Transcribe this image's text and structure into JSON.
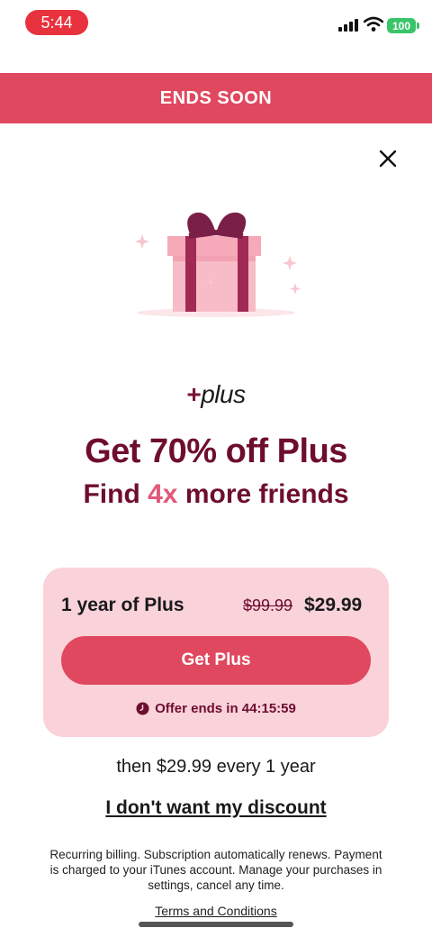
{
  "status_bar": {
    "time": "5:44",
    "battery": "100",
    "battery_color": "#3ac46a",
    "time_pill_color": "#e8323e"
  },
  "banner": {
    "text": "ENDS SOON",
    "color": "#e0485f"
  },
  "brand": {
    "sign": "+",
    "name": "plus"
  },
  "headline": "Get 70% off Plus",
  "subhead": {
    "prefix": "Find ",
    "highlight": "4x",
    "suffix": " more friends"
  },
  "offer": {
    "plan": "1 year of Plus",
    "old_price": "$99.99",
    "new_price": "$29.99",
    "cta_label": "Get Plus",
    "timer_label": "Offer ends in 44:15:59"
  },
  "renewal_text": "then $29.99 every 1 year",
  "decline_label": "I don't want my discount",
  "legal_text": "Recurring billing. Subscription automatically renews. Payment is charged to your iTunes account. Manage your purchases in settings, cancel any time.",
  "terms_label": "Terms and Conditions",
  "icons": {
    "close": "close-icon",
    "gift": "gift-icon",
    "clock": "clock-icon",
    "wifi": "wifi-icon",
    "signal": "signal-icon",
    "battery": "battery-icon"
  },
  "colors": {
    "accent": "#e0485f",
    "dark": "#6e0d30",
    "card": "#f9d2da",
    "highlight": "#e0587a"
  }
}
